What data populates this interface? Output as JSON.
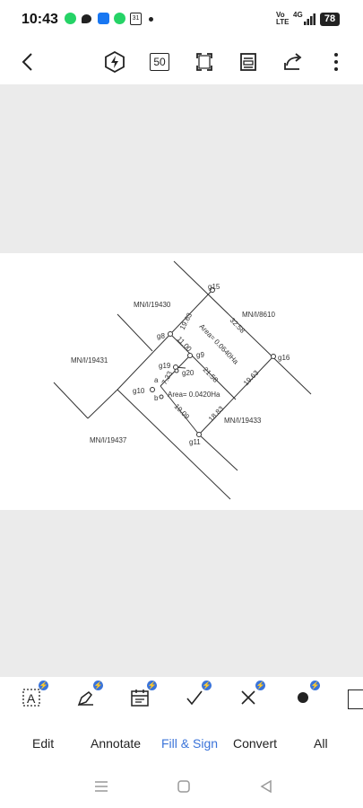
{
  "status_bar": {
    "time": "10:43",
    "calendar_day": "31",
    "volte_line1": "Vo",
    "volte_line2": "LTE",
    "network": "4G",
    "battery": "78"
  },
  "toolbar": {
    "zoom_value": "50"
  },
  "map": {
    "parcels": [
      "MN/I/19430",
      "MN/I/8610",
      "MN/I/19431",
      "MN/I/19433",
      "MN/I/19437"
    ],
    "points": [
      "g15",
      "g8",
      "g9",
      "g16",
      "g19",
      "g20",
      "g10",
      "g11"
    ],
    "small_labels": [
      "a",
      "b"
    ],
    "distances": [
      "19.63",
      "32.58",
      "11.00",
      "21.58",
      "19.63",
      "7.33",
      "19.09",
      "18.83"
    ],
    "area_large": "Area= 0.0640Ha",
    "area_small": "Area= 0.0420Ha"
  },
  "tools": [
    {
      "name": "text-box-tool",
      "icon": "text-box-icon"
    },
    {
      "name": "pen-tool",
      "icon": "pen-icon"
    },
    {
      "name": "date-tool",
      "icon": "calendar-icon"
    },
    {
      "name": "check-tool",
      "icon": "check-icon"
    },
    {
      "name": "cross-tool",
      "icon": "cross-icon"
    },
    {
      "name": "dot-tool",
      "icon": "dot-icon"
    }
  ],
  "tabs": {
    "edit": "Edit",
    "annotate": "Annotate",
    "fill_sign": "Fill & Sign",
    "convert": "Convert",
    "all": "All"
  },
  "colors": {
    "accent": "#3b74d9",
    "background_gray": "#ebebeb",
    "whatsapp": "#25d366",
    "facebook": "#1877f2"
  }
}
